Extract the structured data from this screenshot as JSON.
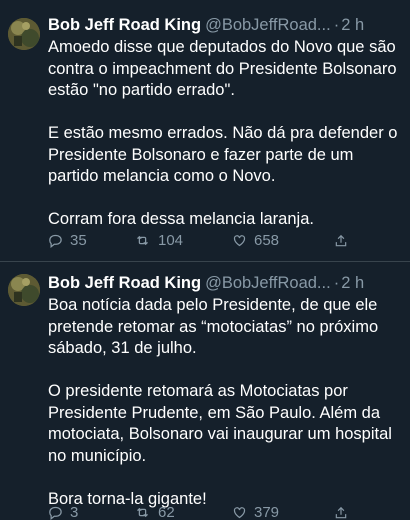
{
  "colors": {
    "background": "#15202b",
    "divider": "#38444d",
    "muted_text": "#8899a6",
    "primary_text": "#ffffff"
  },
  "tweets": [
    {
      "author_name": "Bob Jeff Road King",
      "author_handle": "@BobJeffRoad...",
      "separator": "·",
      "time": "2 h",
      "paragraphs": [
        "Amoedo disse que deputados do Novo que são contra o impeachment do Presidente Bolsonaro estão \"no partido errado\".",
        "E estão mesmo errados. Não dá pra defender o Presidente Bolsonaro e fazer parte de um partido melancia como o Novo.",
        "Corram fora dessa melancia laranja."
      ],
      "replies": "35",
      "retweets": "104",
      "likes": "658",
      "icons": [
        "avatar",
        "reply-icon",
        "retweet-icon",
        "like-icon",
        "share-icon"
      ]
    },
    {
      "author_name": "Bob Jeff Road King",
      "author_handle": "@BobJeffRoad...",
      "separator": "·",
      "time": "2 h",
      "paragraphs": [
        "Boa notícia dada pelo Presidente, de que ele pretende retomar as “motociatas” no próximo sábado, 31 de julho.",
        "O presidente retomará as Motociatas por Presidente Prudente, em São Paulo. Além da motociata, Bolsonaro vai inaugurar um hospital no município.",
        "Bora torna-la gigante!"
      ],
      "replies": "3",
      "retweets": "62",
      "likes": "379",
      "icons": [
        "avatar",
        "reply-icon",
        "retweet-icon",
        "like-icon",
        "share-icon"
      ]
    }
  ]
}
